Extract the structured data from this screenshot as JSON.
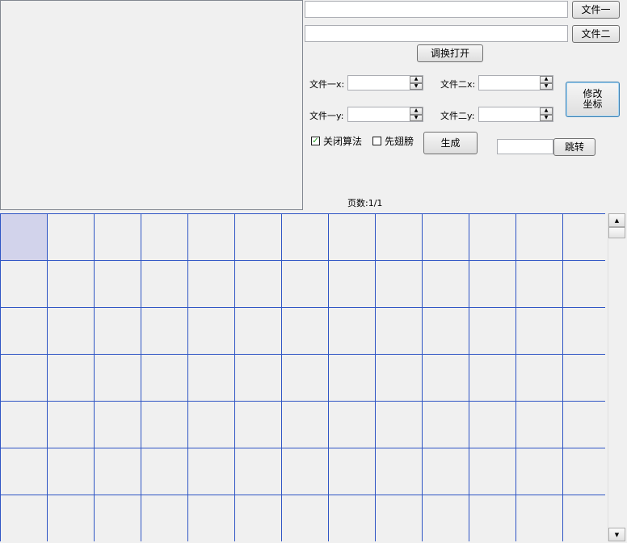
{
  "files": {
    "file1_button": "文件一",
    "file2_button": "文件二",
    "file1_path": "",
    "file2_path": "",
    "swap_open_button": "调换打开"
  },
  "coords": {
    "file1_x_label": "文件一x:",
    "file1_y_label": "文件一y:",
    "file2_x_label": "文件二x:",
    "file2_y_label": "文件二y:",
    "file1_x_value": "",
    "file1_y_value": "",
    "file2_x_value": "",
    "file2_y_value": "",
    "modify_button_line1": "修改",
    "modify_button_line2": "坐标"
  },
  "options": {
    "close_algorithm_label": "关闭算法",
    "close_algorithm_checked": true,
    "first_label": "先翅膀",
    "first_checked": false,
    "generate_button": "生成"
  },
  "navigation": {
    "jump_value": "",
    "jump_button": "跳转",
    "page_label": "页数:1/1"
  },
  "grid": {
    "rows": 7,
    "columns": 13,
    "selected_cell": [
      0,
      0
    ],
    "line_color": "#2f55c5",
    "selected_color": "#d2d3eb"
  },
  "icons": {
    "spin_up": "▲",
    "spin_down": "▼",
    "check_mark": "✓",
    "scroll_up": "▲",
    "scroll_down": "▼"
  }
}
